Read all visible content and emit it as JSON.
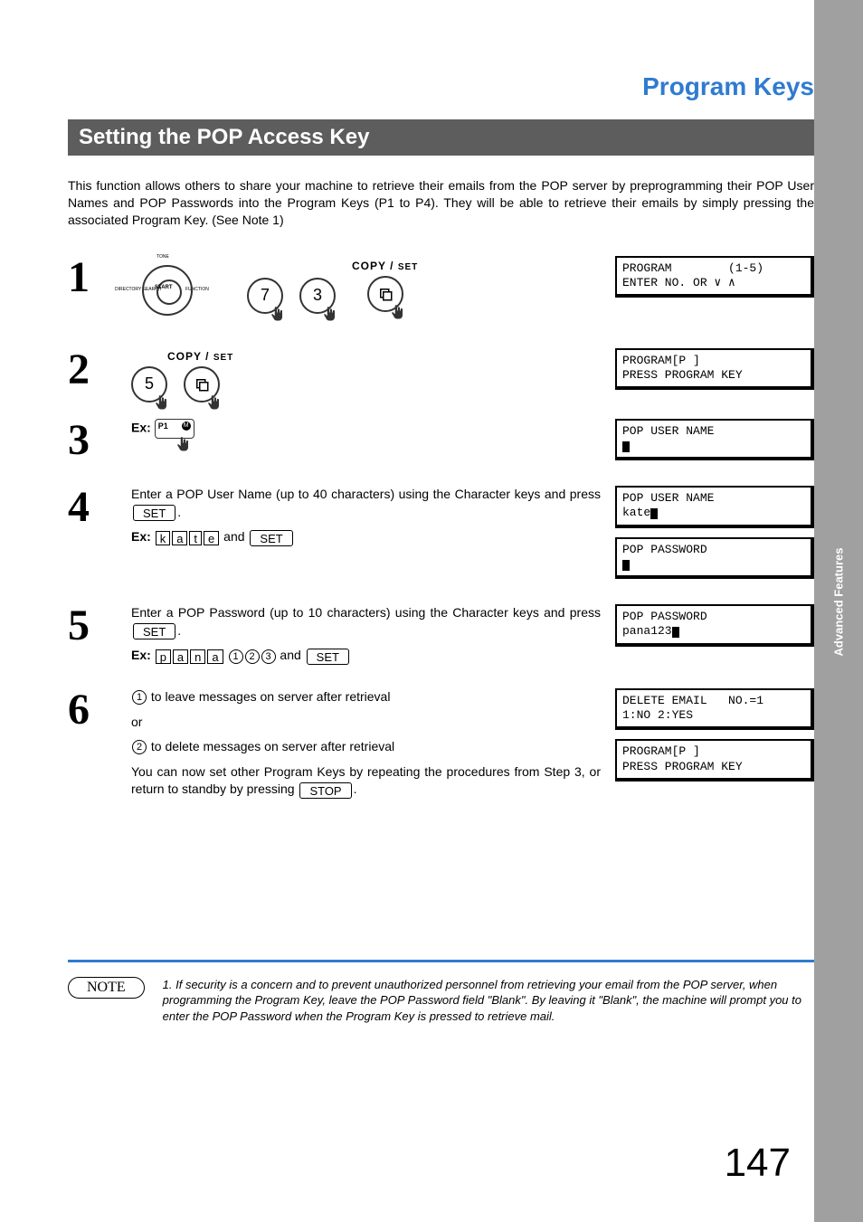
{
  "title": "Program Keys",
  "subtitle": "Setting the POP Access Key",
  "side_tab": "Advanced Features",
  "intro": "This function allows others to share your machine to retrieve their emails from the POP server by preprogramming their POP User Names and POP Passwords into the Program Keys (P1 to P4).  They will be able to retrieve their emails by simply pressing the associated Program Key. (See Note 1)",
  "labels": {
    "copy": "COPY",
    "set": "SET",
    "set_key": "SET",
    "stop_key": "STOP",
    "ex": "Ex:",
    "and": " and ",
    "or": "or"
  },
  "steps": [
    {
      "num": "1",
      "dial": {
        "top": "TONE",
        "left": "DIRECTORY SEARCH",
        "right": "FUNCTION",
        "center": "START"
      },
      "keys": [
        "7",
        "3"
      ],
      "lcd": [
        "PROGRAM        (1-5)",
        "ENTER NO. OR ∨ ∧"
      ]
    },
    {
      "num": "2",
      "keys": [
        "5"
      ],
      "lcd": [
        "PROGRAM[P ]",
        "PRESS PROGRAM KEY"
      ]
    },
    {
      "num": "3",
      "progkey": {
        "label": "P1",
        "badge": "M"
      },
      "lcd": [
        "POP USER NAME"
      ]
    },
    {
      "num": "4",
      "text_a": "Enter a POP User Name (up to 40 characters) using the Character keys and press",
      "text_b": ".",
      "example_chars": [
        "k",
        "a",
        "t",
        "e"
      ],
      "lcd1": [
        "POP USER NAME",
        "kate"
      ],
      "lcd2": [
        "POP PASSWORD"
      ]
    },
    {
      "num": "5",
      "text_a": "Enter a POP Password (up to 10 characters) using the Character keys and press",
      "text_b": ".",
      "example_chars": [
        "p",
        "a",
        "n",
        "a"
      ],
      "example_digits": [
        "1",
        "2",
        "3"
      ],
      "lcd": [
        "POP PASSWORD",
        "pana123"
      ]
    },
    {
      "num": "6",
      "opt1": {
        "key": "1",
        "text": "to leave messages on server after retrieval"
      },
      "opt2": {
        "key": "2",
        "text": "to delete messages on server after retrieval"
      },
      "outro_a": "You can now set other Program Keys by repeating the procedures from Step 3, or return to standby by pressing",
      "outro_b": ".",
      "lcd1": [
        "DELETE EMAIL   NO.=1",
        "1:NO 2:YES"
      ],
      "lcd2": [
        "PROGRAM[P ]",
        "PRESS PROGRAM KEY"
      ]
    }
  ],
  "note": {
    "badge": "NOTE",
    "text": "1. If security is a concern and to prevent unauthorized personnel from retrieving your email from the POP server, when programming the Program Key, leave the POP Password field \"Blank\". By leaving it \"Blank\", the machine will prompt you to enter the POP Password when the Program Key is pressed to retrieve mail."
  },
  "page_number": "147"
}
